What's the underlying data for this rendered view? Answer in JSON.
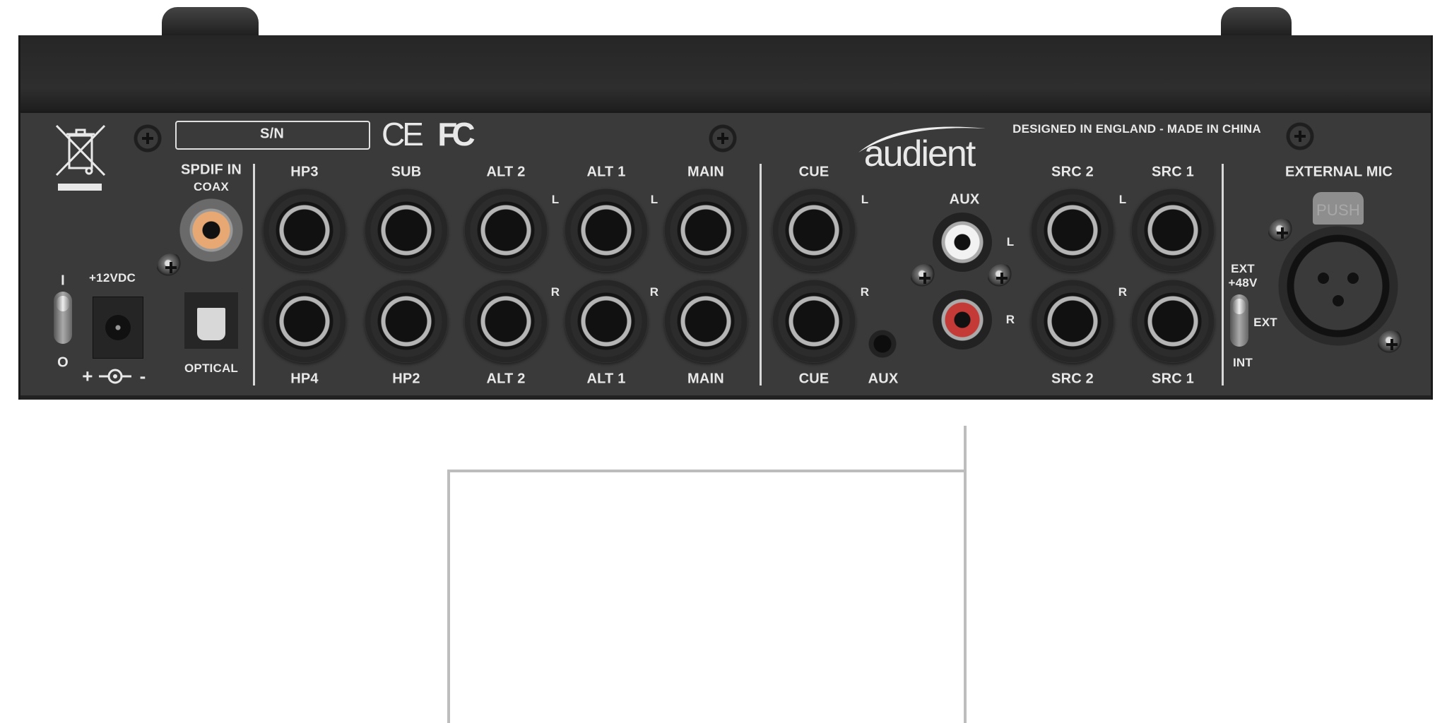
{
  "device": {
    "brand_logo": "audient",
    "origin_text": "DESIGNED IN ENGLAND - MADE IN CHINA",
    "serial_label": "S/N",
    "ce_mark": "CE",
    "fcc_mark": "FC",
    "accent_colors": {
      "panel": "#3a3a3b",
      "text": "#e8e8e8",
      "coax": "#e7a873",
      "rca_left": "#f2f2f2",
      "rca_right": "#c43a36",
      "callout": "#bdbdbd"
    }
  },
  "power": {
    "switch_on": "I",
    "switch_off": "O",
    "dc_label": "+12VDC",
    "polarity_plus": "+",
    "polarity_minus": "-"
  },
  "spdif": {
    "title": "SPDIF IN",
    "coax": "COAX",
    "optical": "OPTICAL"
  },
  "outputs": {
    "top": [
      "HP3",
      "SUB",
      "ALT 2",
      "ALT 1",
      "MAIN"
    ],
    "bottom": [
      "HP4",
      "HP2",
      "ALT 2",
      "ALT 1",
      "MAIN"
    ],
    "left": "L",
    "right": "R"
  },
  "cue": {
    "top": "CUE",
    "bottom": "CUE",
    "left": "L",
    "right": "R"
  },
  "aux": {
    "rca_title": "AUX",
    "mini_label": "AUX",
    "left": "L",
    "right": "R"
  },
  "sources": {
    "top": [
      "SRC 2",
      "SRC 1"
    ],
    "bottom": [
      "SRC 2",
      "SRC 1"
    ],
    "left": "L",
    "right": "R"
  },
  "mic": {
    "title": "EXTERNAL MIC",
    "push": "PUSH",
    "phantom_line1": "EXT",
    "phantom_line2": "+48V",
    "switch_ext": "EXT",
    "switch_int": "INT"
  }
}
